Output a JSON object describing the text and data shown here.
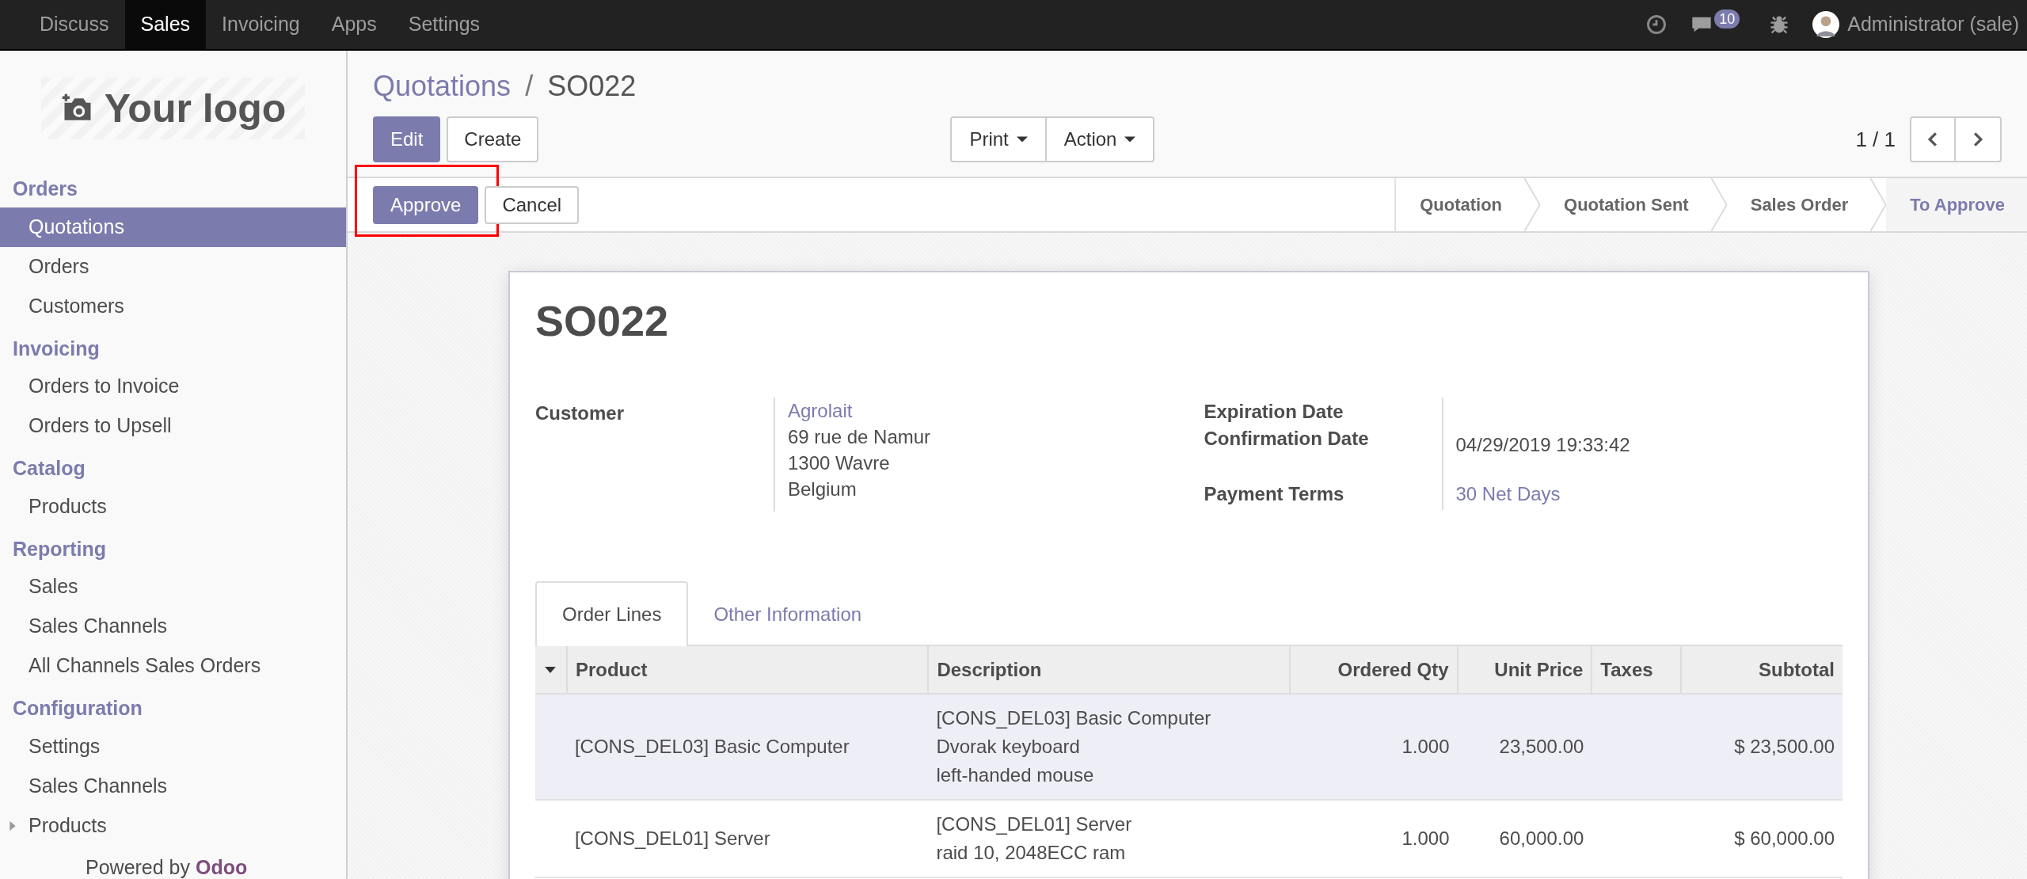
{
  "top_menu": [
    {
      "label": "Discuss",
      "selected": false
    },
    {
      "label": "Sales",
      "selected": true
    },
    {
      "label": "Invoicing",
      "selected": false
    },
    {
      "label": "Apps",
      "selected": false
    },
    {
      "label": "Settings",
      "selected": false
    }
  ],
  "systray": {
    "message_count": "10",
    "user": "Administrator (sale)"
  },
  "sidebar": {
    "logo": "Your logo",
    "sections": [
      {
        "title": "Orders",
        "items": [
          {
            "label": "Quotations",
            "selected": true,
            "kind": "link"
          },
          {
            "label": "Orders",
            "selected": false,
            "kind": "link"
          },
          {
            "label": "Customers",
            "selected": false,
            "kind": "link"
          }
        ]
      },
      {
        "title": "Invoicing",
        "items": [
          {
            "label": "Orders to Invoice",
            "selected": false,
            "kind": "link"
          },
          {
            "label": "Orders to Upsell",
            "selected": false,
            "kind": "link"
          }
        ]
      },
      {
        "title": "Catalog",
        "items": [
          {
            "label": "Products",
            "selected": false,
            "kind": "link"
          }
        ]
      },
      {
        "title": "Reporting",
        "items": [
          {
            "label": "Sales",
            "selected": false,
            "kind": "link"
          },
          {
            "label": "Sales Channels",
            "selected": false,
            "kind": "link"
          },
          {
            "label": "All Channels Sales Orders",
            "selected": false,
            "kind": "link"
          }
        ]
      },
      {
        "title": "Configuration",
        "items": [
          {
            "label": "Settings",
            "selected": false,
            "kind": "link"
          },
          {
            "label": "Sales Channels",
            "selected": false,
            "kind": "link"
          },
          {
            "label": "Products",
            "selected": false,
            "kind": "folder",
            "expanded": false
          }
        ]
      }
    ],
    "footer_prefix": "Powered by",
    "footer_brand": "Odoo"
  },
  "breadcrumb": {
    "parent": "Quotations",
    "separator": "/",
    "current": "SO022"
  },
  "buttons": [
    "Edit",
    "Create"
  ],
  "dropdowns": [
    "Print",
    "Action"
  ],
  "pager": "1 / 1",
  "status_bar": {
    "buttons": [
      {
        "label": "Approve",
        "kind": "primary",
        "highlighted": true
      },
      {
        "label": "Cancel",
        "kind": "secondary",
        "highlighted": false
      }
    ],
    "steps": [
      {
        "label": "Quotation",
        "selected": false
      },
      {
        "label": "Quotation Sent",
        "selected": false
      },
      {
        "label": "Sales Order",
        "selected": false
      },
      {
        "label": "To Approve",
        "selected": true
      }
    ]
  },
  "form": {
    "title": "SO022",
    "customer": {
      "label": "Customer",
      "name": "Agrolait",
      "address": [
        "69 rue de Namur",
        "1300 Wavre",
        "Belgium"
      ]
    },
    "fields": [
      {
        "label": "Expiration Date"
      },
      {
        "label": "Confirmation Date",
        "value": "04/29/2019 19:33:42",
        "kind": "text"
      },
      {
        "label": "Payment Terms",
        "value": "30 Net Days",
        "kind": "link"
      }
    ],
    "tabs": [
      {
        "label": "Order Lines",
        "selected": true
      },
      {
        "label": "Other Information",
        "selected": false
      }
    ],
    "table": {
      "columns": [
        "Product",
        "Description",
        "Ordered Qty",
        "Unit Price",
        "Taxes",
        "Subtotal"
      ],
      "rows": [
        {
          "selected": true,
          "cells": [
            "[CONS_DEL03] Basic Computer",
            [
              "[CONS_DEL03] Basic Computer",
              "Dvorak keyboard",
              "left-handed mouse"
            ],
            "1.000",
            "23,500.00",
            "",
            "$ 23,500.00"
          ]
        },
        {
          "selected": false,
          "cells": [
            "[CONS_DEL01] Server",
            [
              "[CONS_DEL01] Server",
              "raid 10, 2048ECC ram"
            ],
            "1.000",
            "60,000.00",
            "",
            "$ 60,000.00"
          ]
        }
      ]
    }
  }
}
